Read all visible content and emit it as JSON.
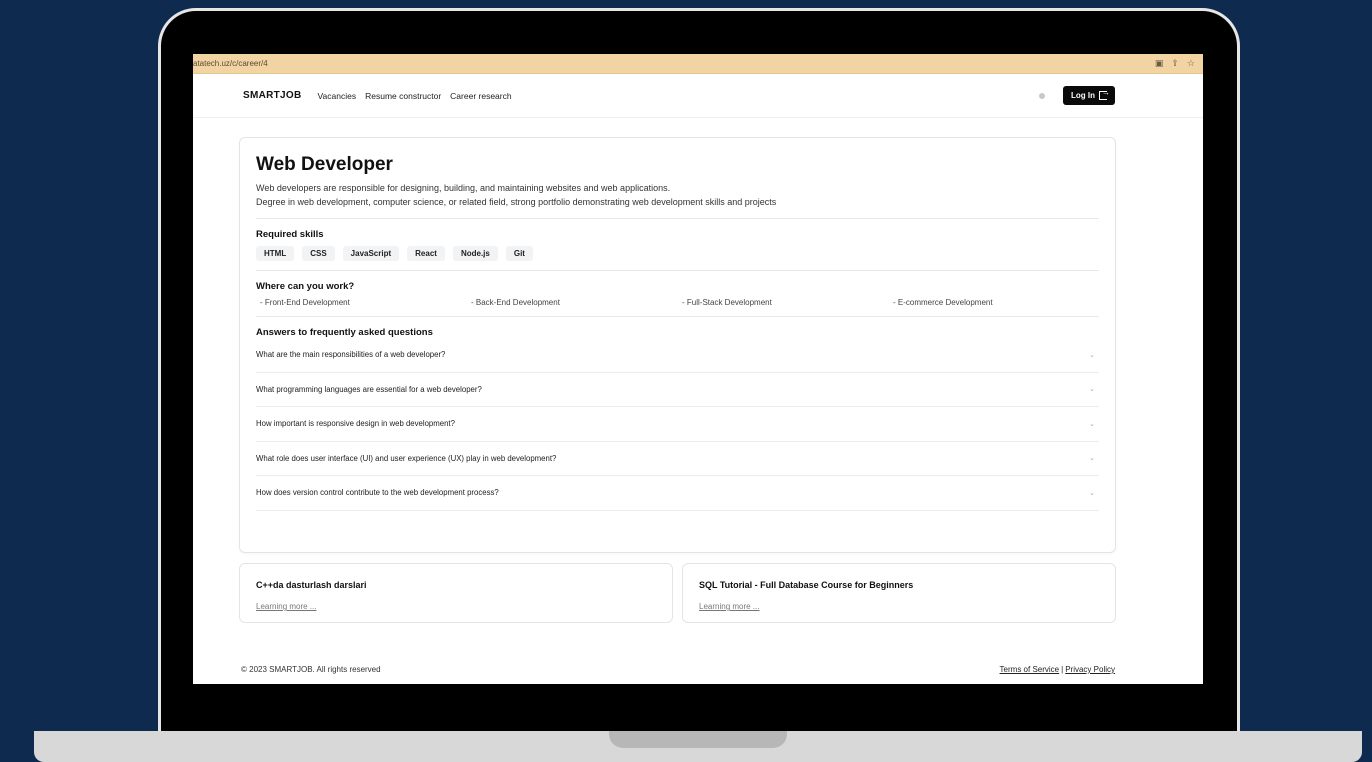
{
  "browser": {
    "url": "atatech.uz/c/career/4"
  },
  "nav": {
    "logo": "SMARTJOB",
    "links": [
      "Vacancies",
      "Resume constructor",
      "Career research"
    ],
    "login_label": "Log In"
  },
  "career": {
    "title": "Web Developer",
    "description": [
      "Web developers are responsible for designing, building, and maintaining websites and web applications.",
      "Degree in web development, computer science, or related field, strong portfolio demonstrating web development skills and projects"
    ],
    "skills_heading": "Required skills",
    "skills": [
      "HTML",
      "CSS",
      "JavaScript",
      "React",
      "Node.js",
      "Git"
    ],
    "workplaces_heading": "Where can you work?",
    "workplaces": [
      "- Front-End Development",
      "- Back-End Development",
      "- Full-Stack Development",
      "- E-commerce Development"
    ],
    "faq_heading": "Answers to frequently asked questions",
    "faq": [
      "What are the main responsibilities of a web developer?",
      "What programming languages are essential for a web developer?",
      "How important is responsive design in web development?",
      "What role does user interface (UI) and user experience (UX) play in web development?",
      "How does version control contribute to the web development process?"
    ]
  },
  "courses": [
    {
      "title": "C++da dasturlash darslari",
      "link": "Learning more ..."
    },
    {
      "title": "SQL Tutorial - Full Database Course for Beginners",
      "link": "Learning more ..."
    }
  ],
  "footer": {
    "copyright": "© 2023 SMARTJOB. All rights reserved",
    "terms": "Terms of Service",
    "separator": "|",
    "privacy": "Privacy Policy"
  }
}
